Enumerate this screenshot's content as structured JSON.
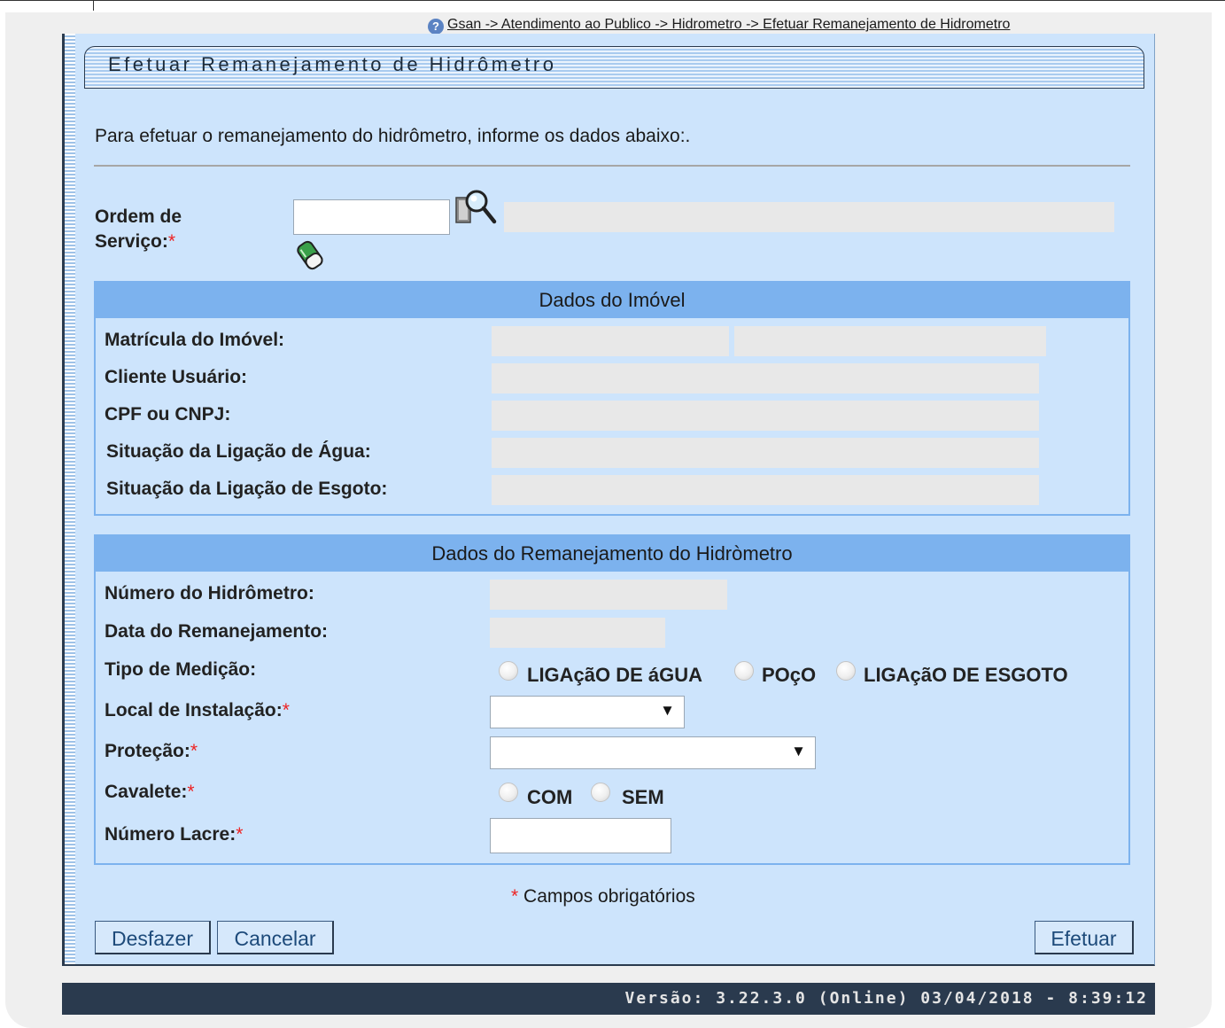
{
  "breadcrumb": "Gsan -> Atendimento ao Publico -> Hidrometro -> Efetuar Remanejamento de Hidrometro",
  "title": "Efetuar Remanejamento de Hidrômetro",
  "intro": "Para efetuar o remanejamento do hidrômetro, informe os dados abaixo:.",
  "ordem_servico": {
    "label_line1": "Ordem de",
    "label_line2": "Serviço:",
    "required_mark": "*",
    "value": "",
    "description": ""
  },
  "dados_imovel": {
    "header": "Dados do Imóvel",
    "fields": [
      {
        "label": "Matrícula do Imóvel:",
        "value": "",
        "value2": ""
      },
      {
        "label": "Cliente Usuário:",
        "value": ""
      },
      {
        "label": "CPF ou CNPJ:",
        "value": ""
      },
      {
        "label": "Situação da Ligação de Água:",
        "value": ""
      },
      {
        "label": "Situação da Ligação de Esgoto:",
        "value": ""
      }
    ]
  },
  "dados_remanejamento": {
    "header": "Dados do Remanejamento do Hidròmetro",
    "numero_hidrometro_label": "Número do Hidrômetro:",
    "data_remanejamento_label": "Data do Remanejamento:",
    "tipo_medicao": {
      "label": "Tipo de Medição:",
      "options": [
        "LIGAçãO DE áGUA",
        "POçO",
        "LIGAçãO DE ESGOTO"
      ]
    },
    "local_instalacao": {
      "label": "Local de Instalação:",
      "selected": ""
    },
    "protecao": {
      "label": "Proteção:",
      "selected": ""
    },
    "cavalete": {
      "label": "Cavalete:",
      "options": [
        "COM",
        "SEM"
      ]
    },
    "numero_lacre": {
      "label": "Número Lacre:",
      "value": ""
    },
    "required_mark": "*"
  },
  "required_note": {
    "mark": "*",
    "text": " Campos obrigatórios"
  },
  "buttons": {
    "desfazer": "Desfazer",
    "cancelar": "Cancelar",
    "efetuar": "Efetuar"
  },
  "footer": "Versão: 3.22.3.0 (Online) 03/04/2018 - 8:39:12",
  "colors": {
    "panel": "#cde4fc",
    "section_header": "#7cb2ee",
    "footer": "#2a3a4e",
    "required": "#e22222"
  },
  "icons": [
    "help-icon",
    "search-icon",
    "eraser-icon",
    "chevron-down-icon"
  ]
}
